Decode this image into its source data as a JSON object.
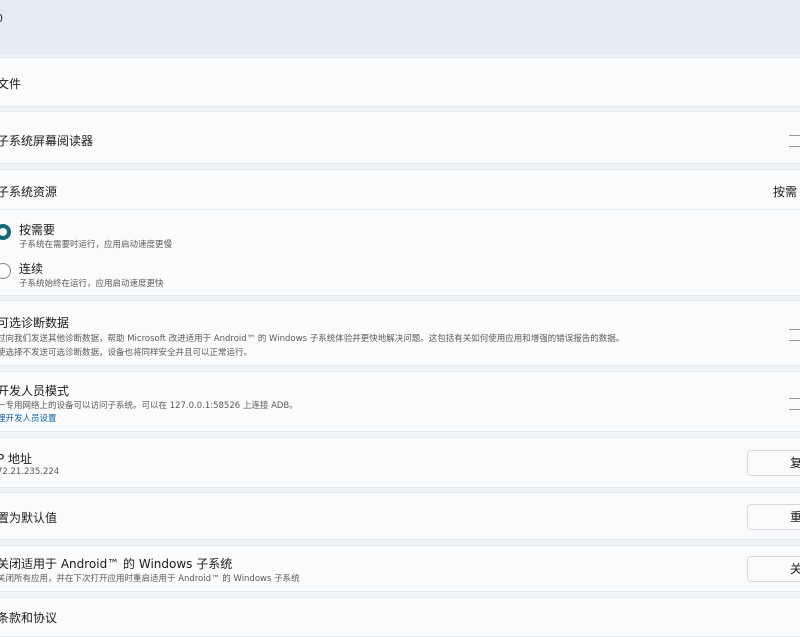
{
  "header": {
    "version_fragment": "0"
  },
  "rows": {
    "files": {
      "title": "文件"
    },
    "screen_reader": {
      "title": "子系统屏幕阅读器"
    },
    "resources": {
      "title": "子系统资源",
      "dropdown_value": "按需",
      "options": [
        {
          "label": "按需要",
          "desc": "子系统在需要时运行，应用启动速度更慢",
          "selected": true
        },
        {
          "label": "连续",
          "desc": "子系统始终在运行，应用启动速度更快",
          "selected": false
        }
      ]
    },
    "diagnostics": {
      "title": "可选诊断数据",
      "desc1": "过向我们发送其他诊断数据，帮助 Microsoft 改进适用于 Android™ 的 Windows 子系统体验并更快地解决问题。这包括有关如何使用应用和增强的错误报告的数据。",
      "desc2": "使选择不发送可选诊断数据，设备也将同样安全并且可以正常运行。"
    },
    "developer": {
      "title": "开发人员模式",
      "desc": "一专用网络上的设备可以访问子系统。可以在 127.0.0.1:58526 上连接 ADB。",
      "link": "理开发人员设置"
    },
    "ip": {
      "title": "P 地址",
      "value": "72.21.235.224",
      "button": "复"
    },
    "reset": {
      "title": "置为默认值",
      "button": "重"
    },
    "shutdown": {
      "title": "关闭适用于 Android™ 的 Windows 子系统",
      "desc": "关闭所有应用，并在下次打开应用时重启适用于 Android™ 的 Windows 子系统",
      "button": "关"
    },
    "terms": {
      "title": "条款和协议"
    }
  },
  "colors": {
    "accent": "#0f6b74",
    "link": "#0b5ea8",
    "background": "#eef3f8",
    "card": "#f9fbfd"
  }
}
